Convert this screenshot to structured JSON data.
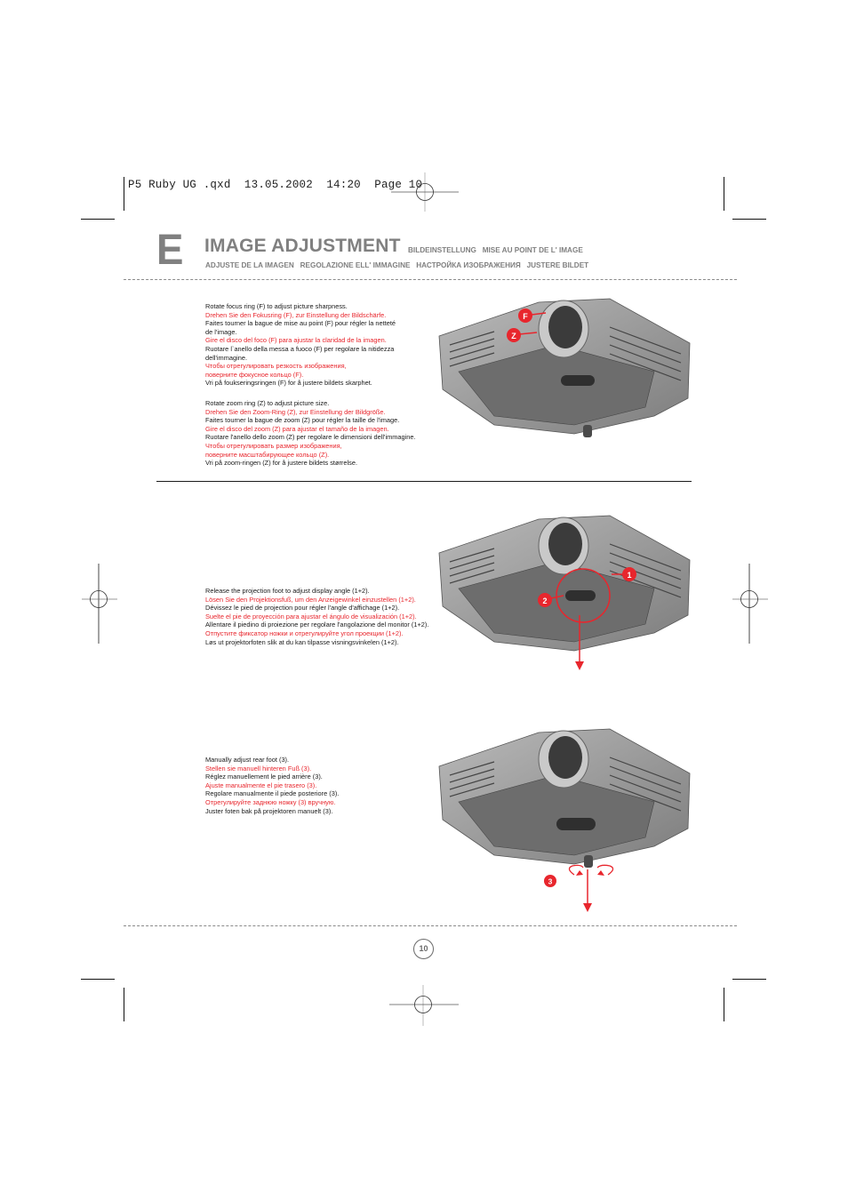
{
  "slug": "P5 Ruby UG .qxd  13.05.2002  14:20  Page 10",
  "section_letter": "E",
  "header": {
    "title": "IMAGE ADJUSTMENT",
    "subtitle_line1": "BILDEINSTELLUNG   MISE AU POINT DE L' IMAGE",
    "subtitle_line2": "ADJUSTE DE LA IMAGEN   REGOLAZIONE ELL' IMMAGINE   НАСТРОЙКА ИЗОБРАЖЕНИЯ   JUSTERE BILDET"
  },
  "colors": {
    "accent": "#e8262d",
    "heading_gray": "#808080",
    "text": "#1a1a1a"
  },
  "sections": [
    {
      "id": "focus",
      "lines": [
        {
          "text": "Rotate focus ring (F) to adjust picture sharpness.",
          "red": false
        },
        {
          "text": "Drehen Sie den Fokusring (F), zur Einstellung der Bildschärfe.",
          "red": true
        },
        {
          "text": "Faites tourner la bague de mise au point (F) pour régler la netteté",
          "red": false
        },
        {
          "text": "de l'image.",
          "red": false
        },
        {
          "text": "Gire el disco del foco (F) para ajustar la claridad de la imagen.",
          "red": true
        },
        {
          "text": "Ruotare l`anello della messa a fuoco (F) per regolare la nitidezza",
          "red": false
        },
        {
          "text": "dell'immagine.",
          "red": false
        },
        {
          "text": "Чтобы отрегулировать резкость изображения,",
          "red": true
        },
        {
          "text": "поверните фокусное кольцо (F).",
          "red": true
        },
        {
          "text": "Vri på foukseringsringen (F) for å justere bildets skarphet.",
          "red": false
        }
      ]
    },
    {
      "id": "zoom",
      "lines": [
        {
          "text": "Rotate zoom ring (Z) to adjust picture size.",
          "red": false
        },
        {
          "text": "Drehen Sie den Zoom-Ring (Z), zur Einstellung der Bildgröße.",
          "red": true
        },
        {
          "text": "Faites tourner la bague de zoom (Z) pour régler la taille de l'image.",
          "red": false
        },
        {
          "text": "Gire el disco del zoom (Z) para ajustar el tamaño de la imagen.",
          "red": true
        },
        {
          "text": "Ruotare l'anello dello zoom (Z) per regolare le dimensioni dell'immagine.",
          "red": false
        },
        {
          "text": "Чтобы отрегулировать размер изображения,",
          "red": true
        },
        {
          "text": "поверните масштабирующее кольцо (Z).",
          "red": true
        },
        {
          "text": "Vri på zoom-ringen (Z) for å justere bildets størrelse.",
          "red": false
        }
      ]
    },
    {
      "id": "projection-foot",
      "lines": [
        {
          "text": "Release the projection foot to adjust display angle (1+2).",
          "red": false
        },
        {
          "text": "Lösen Sie den Projektionsfuß, um den Anzeigewinkel einzustellen (1+2).",
          "red": true
        },
        {
          "text": "Dévissez le pied de projection pour régler l'angle d'affichage (1+2).",
          "red": false
        },
        {
          "text": "Suelte el pie de proyección para ajustar el ángulo de visualización (1+2).",
          "red": true
        },
        {
          "text": "Allentare il piedino di proiezione per regolare l'angolazione del monitor (1+2).",
          "red": false
        },
        {
          "text": "Отпустите фиксатор ножки и отрегулируйте угол проекции (1+2).",
          "red": true
        },
        {
          "text": "Løs ut projektorfoten slik at du kan tilpasse visningsvinkelen (1+2).",
          "red": false
        }
      ]
    },
    {
      "id": "rear-foot",
      "lines": [
        {
          "text": "Manually adjust rear foot (3).",
          "red": false
        },
        {
          "text": "Stellen sie manuell hinteren Fuß (3).",
          "red": true
        },
        {
          "text": "Réglez manuellement le pied arrière (3).",
          "red": false
        },
        {
          "text": "Ajuste manualmente el pie trasero (3).",
          "red": true
        },
        {
          "text": "Regolare manualmente il piede posteriore (3).",
          "red": false
        },
        {
          "text": "Отрегулируйте заднюю ножку (3) вручную.",
          "red": true
        },
        {
          "text": "Juster foten bak på projektoren manuelt (3).",
          "red": false
        }
      ]
    }
  ],
  "markers": {
    "focus": "F",
    "zoom": "Z",
    "step1": "1",
    "step2": "2",
    "step3": "3"
  },
  "page_number": "10"
}
